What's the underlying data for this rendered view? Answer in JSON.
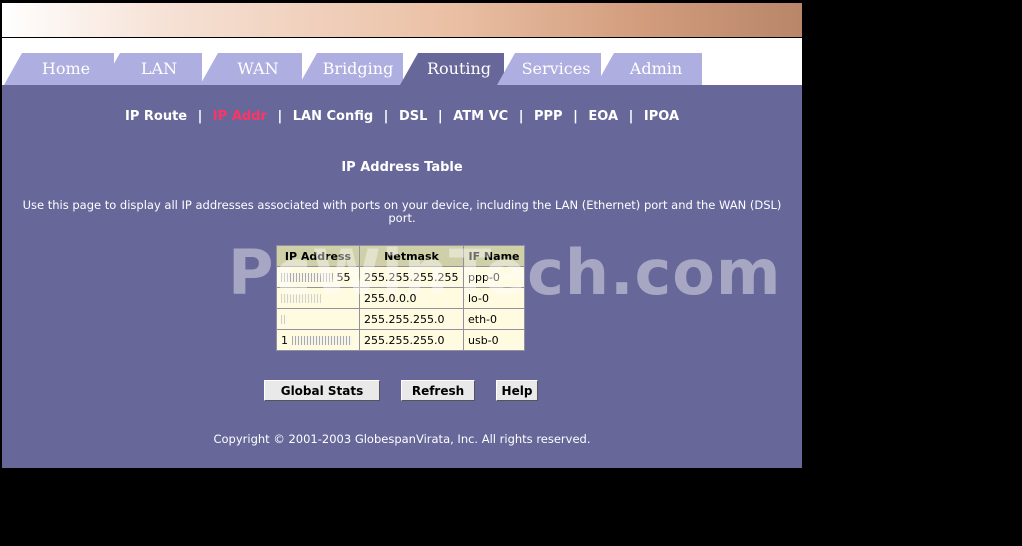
{
  "tabs": [
    {
      "label": "Home",
      "active": false
    },
    {
      "label": "LAN",
      "active": false
    },
    {
      "label": "WAN",
      "active": false
    },
    {
      "label": "Bridging",
      "active": false
    },
    {
      "label": "Routing",
      "active": true
    },
    {
      "label": "Services",
      "active": false
    },
    {
      "label": "Admin",
      "active": false
    }
  ],
  "subnav": [
    {
      "label": "IP Route",
      "current": false
    },
    {
      "label": "IP Addr",
      "current": true
    },
    {
      "label": "LAN Config",
      "current": false
    },
    {
      "label": "DSL",
      "current": false
    },
    {
      "label": "ATM VC",
      "current": false
    },
    {
      "label": "PPP",
      "current": false
    },
    {
      "label": "EOA",
      "current": false
    },
    {
      "label": "IPOA",
      "current": false
    }
  ],
  "subnav_separator": "|",
  "page_title": "IP Address Table",
  "description": "Use this page to display all IP addresses associated with ports on your device, including the LAN (Ethernet) port and the WAN (DSL) port.",
  "table": {
    "headers": [
      "IP Address",
      "Netmask",
      "IF Name"
    ],
    "rows": [
      {
        "ip_visible": "55",
        "netmask": "255.255.255.255",
        "ifname": "ppp-0"
      },
      {
        "ip_visible": "",
        "netmask": "255.0.0.0",
        "ifname": "lo-0"
      },
      {
        "ip_visible": "",
        "netmask": "255.255.255.0",
        "ifname": "eth-0"
      },
      {
        "ip_visible": "1",
        "netmask": "255.255.255.0",
        "ifname": "usb-0"
      }
    ]
  },
  "buttons": {
    "global_stats": "Global Stats",
    "refresh": "Refresh",
    "help": "Help"
  },
  "copyright": "Copyright © 2001-2003 GlobespanVirata, Inc. All rights reserved.",
  "watermark": "PcWinTech.com"
}
